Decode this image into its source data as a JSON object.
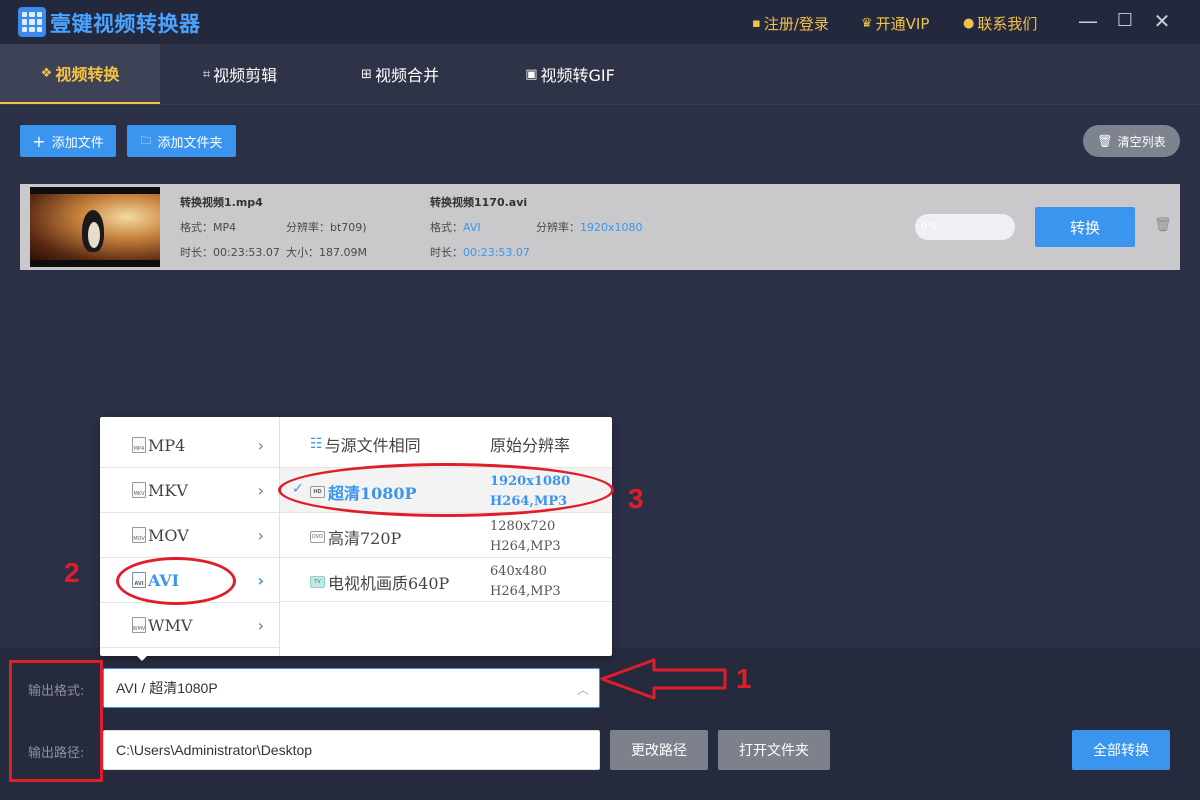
{
  "app": {
    "title": "壹键视频转换器",
    "links": {
      "register": "注册/登录",
      "vip": "开通VIP",
      "contact": "联系我们"
    }
  },
  "tabs": [
    {
      "label": "视频转换",
      "active": true
    },
    {
      "label": "视频剪辑"
    },
    {
      "label": "视频合并"
    },
    {
      "label": "视频转GIF"
    }
  ],
  "toolbar": {
    "add_file": "添加文件",
    "add_folder": "添加文件夹",
    "clear_list": "清空列表"
  },
  "file": {
    "source_name": "转换视频1.mp4",
    "source_format_label": "格式：",
    "source_format": "MP4",
    "source_resolution_label": "分辨率：",
    "source_resolution": "bt709)",
    "source_duration_label": "时长：",
    "source_duration": "00:23:53.07",
    "source_size_label": "大小：",
    "source_size": "187.09M",
    "target_name": "转换视频1170.avi",
    "target_format_label": "格式：",
    "target_format": "AVI",
    "target_resolution_label": "分辨率：",
    "target_resolution": "1920x1080",
    "target_duration_label": "时长：",
    "target_duration": "00:23:53.07",
    "progress_text": "0%",
    "progress_fraction": 0,
    "convert": "转换"
  },
  "formats": [
    {
      "icon": "MP4",
      "label": "MP4"
    },
    {
      "icon": "MKV",
      "label": "MKV"
    },
    {
      "icon": "MOV",
      "label": "MOV"
    },
    {
      "icon": "AVI",
      "label": "AVI",
      "active": true
    },
    {
      "icon": "WMV",
      "label": "WMV"
    }
  ],
  "quality_header": {
    "left": "与源文件相同",
    "right": "原始分辨率"
  },
  "qualities": [
    {
      "icon": "HD",
      "label": "超清1080P",
      "res1": "1920x1080",
      "res2": "H264,MP3",
      "active": true
    },
    {
      "icon": "DVD",
      "label": "高清720P",
      "res1": "1280x720",
      "res2": "H264,MP3"
    },
    {
      "icon": "TV",
      "label": "电视机画质640P",
      "res1": "640x480",
      "res2": "H264,MP3"
    }
  ],
  "output": {
    "format_label": "输出格式:",
    "format_value": "AVI / 超清1080P",
    "path_label": "输出路径:",
    "path_value": "C:\\Users\\Administrator\\Desktop",
    "change_path": "更改路径",
    "open_folder": "打开文件夹",
    "convert_all": "全部转换"
  },
  "annotations": {
    "n1": "1",
    "n2": "2",
    "n3": "3"
  }
}
